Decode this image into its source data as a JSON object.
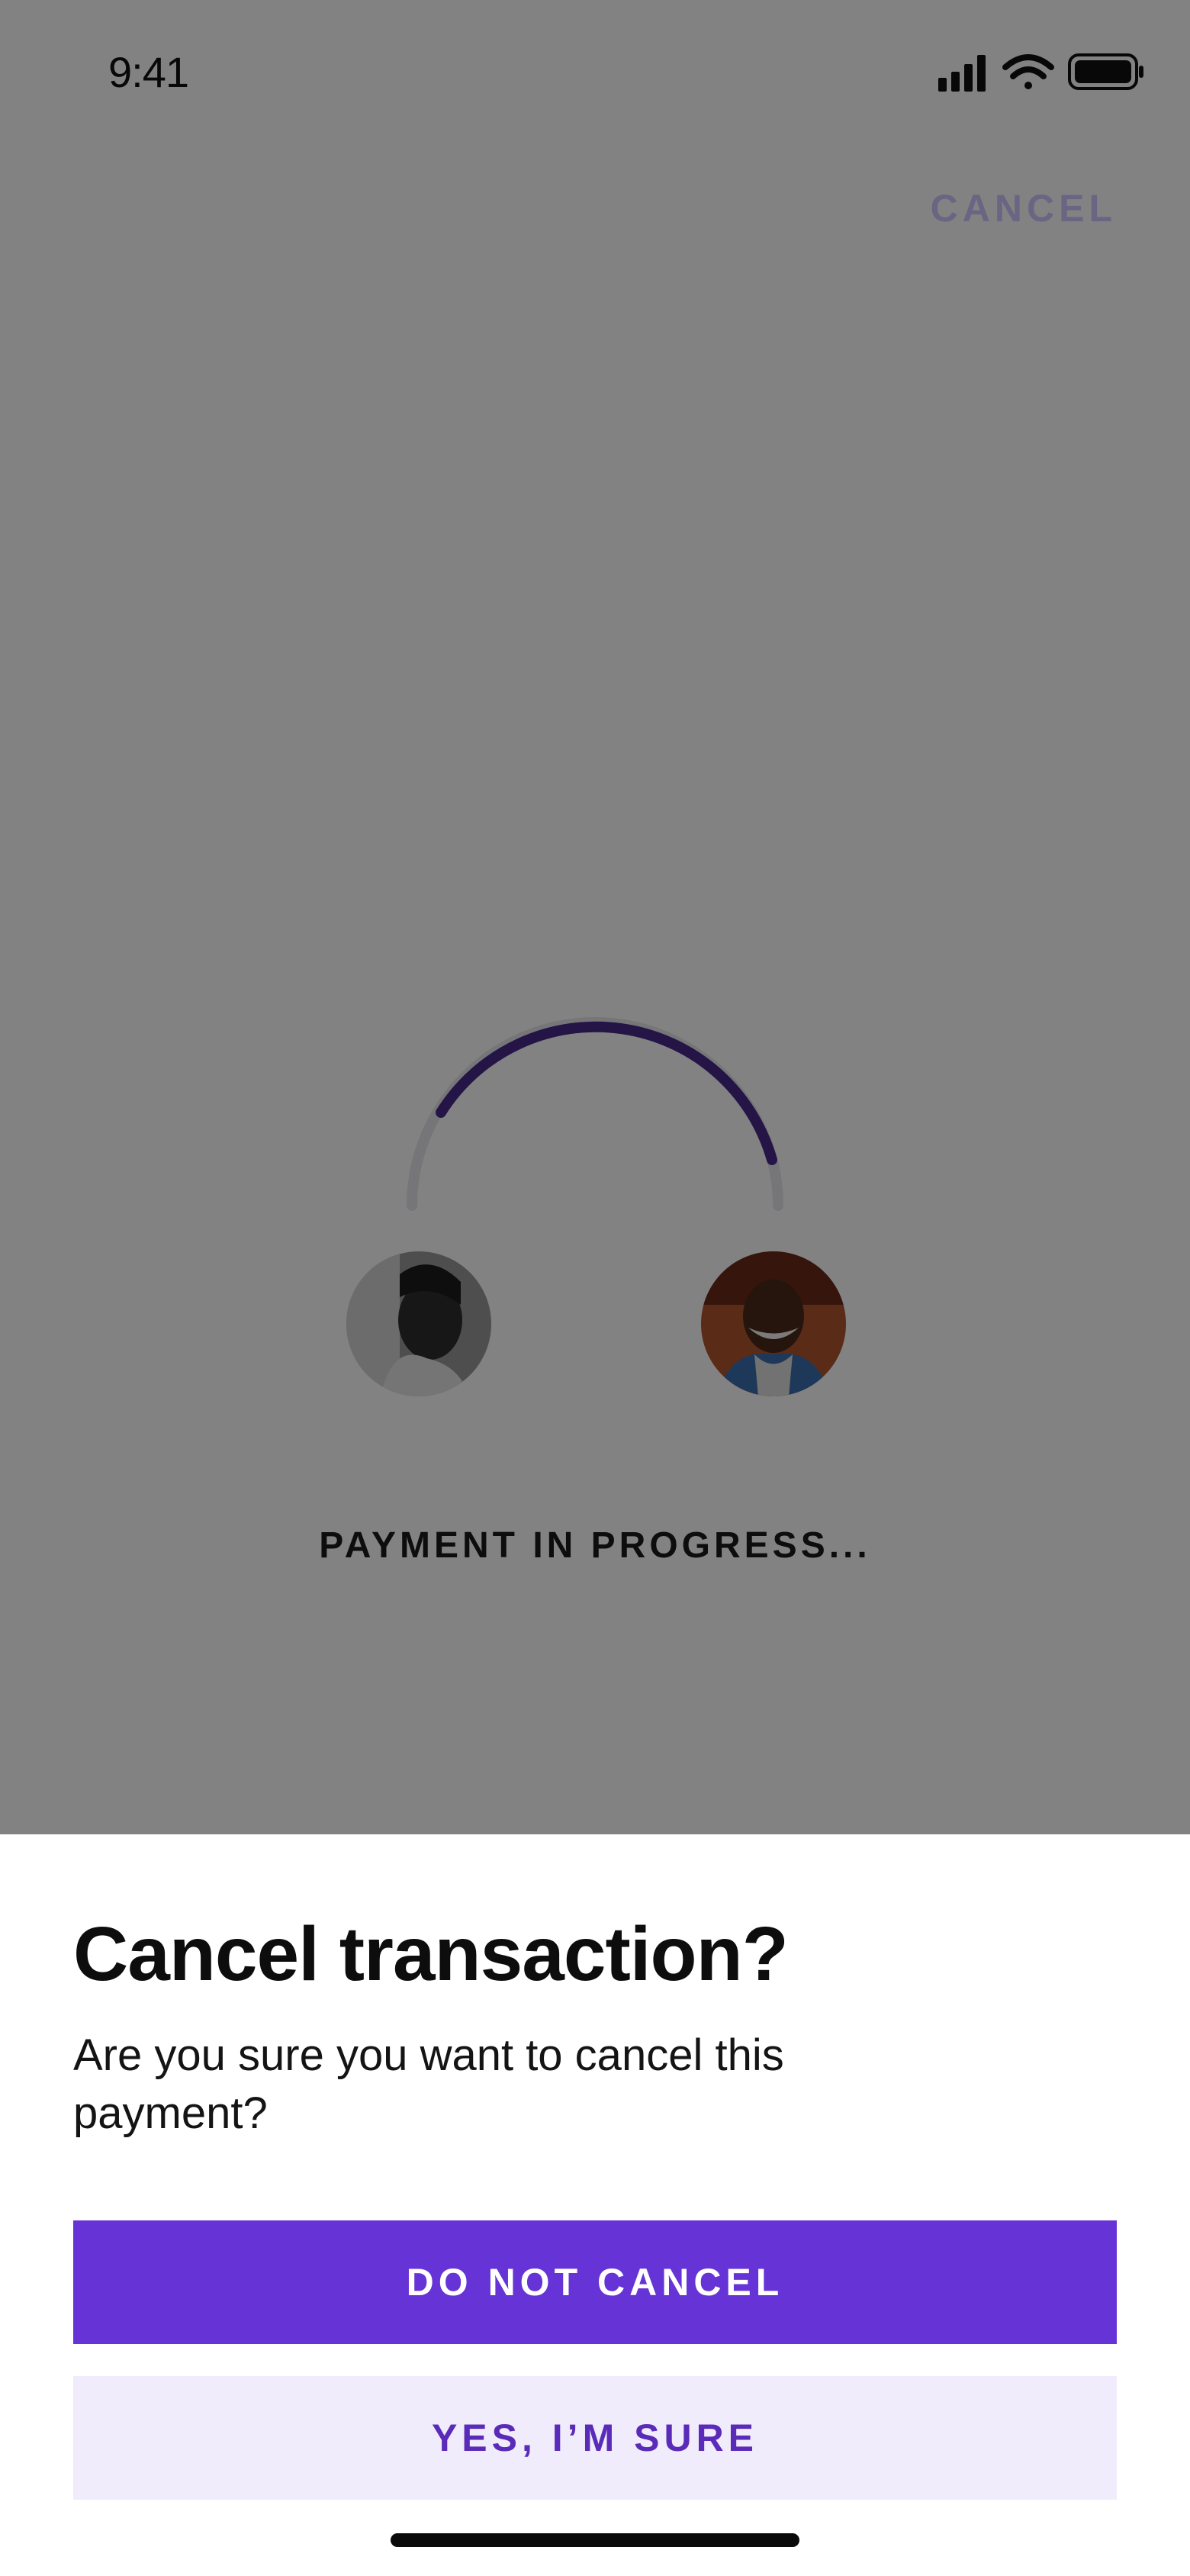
{
  "status_bar": {
    "time": "9:41",
    "icons": [
      "cellular-signal-icon",
      "wifi-icon",
      "battery-icon"
    ]
  },
  "header": {
    "cancel_label": "CANCEL"
  },
  "payment": {
    "status_text": "PAYMENT IN PROGRESS...",
    "sender_avatar": "sender-avatar-photo",
    "recipient_avatar": "recipient-avatar-photo"
  },
  "dialog": {
    "title": "Cancel transaction?",
    "message": "Are you sure you want to cancel this payment?",
    "primary_button": "DO NOT CANCEL",
    "secondary_button": "YES, I’M SURE"
  },
  "colors": {
    "accent": "#6633d6",
    "accent_light": "#f1ecfb",
    "arc": "#4a2a8c"
  }
}
